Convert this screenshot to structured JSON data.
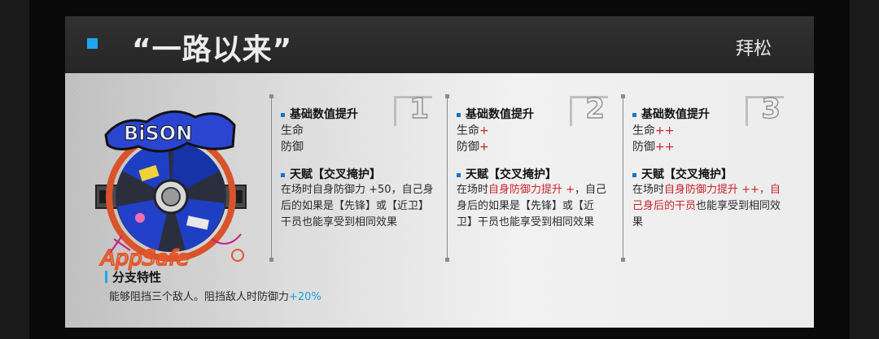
{
  "header": {
    "title": "“一路以来”",
    "operator": "拜松"
  },
  "levels": [
    {
      "num": "1",
      "stats_title": "基础数值提升",
      "stats": [
        {
          "label": "生命",
          "plus": ""
        },
        {
          "label": "防御",
          "plus": ""
        }
      ],
      "talent_title": "天赋【交叉掩护】",
      "talent_parts": [
        {
          "text": "在场时自身防御力 +50，自己身后的如果是【先锋】或【近卫】干员也能享受到相同效果",
          "red": false
        }
      ]
    },
    {
      "num": "2",
      "stats_title": "基础数值提升",
      "stats": [
        {
          "label": "生命",
          "plus": "+"
        },
        {
          "label": "防御",
          "plus": "+"
        }
      ],
      "talent_title": "天赋【交叉掩护】",
      "talent_parts": [
        {
          "text": "在场时",
          "red": false
        },
        {
          "text": "自身防御力提升 +",
          "red": true
        },
        {
          "text": "，自己身后的如果是【先锋】或【近卫】干员也能享受到相同效果",
          "red": false
        }
      ]
    },
    {
      "num": "3",
      "stats_title": "基础数值提升",
      "stats": [
        {
          "label": "生命",
          "plus": "++"
        },
        {
          "label": "防御",
          "plus": "++"
        }
      ],
      "talent_title": "天赋【交叉掩护】",
      "talent_parts": [
        {
          "text": "在场时",
          "red": false
        },
        {
          "text": "自身防御力提升 ++，自己身后的干员",
          "red": true
        },
        {
          "text": "也能享受到相同效果",
          "red": false
        }
      ]
    }
  ],
  "branch": {
    "title": "分支特性",
    "text": "能够阻挡三个敌人。阻挡敌人时防御力",
    "bonus": "+20%"
  },
  "colors": {
    "accent": "#1ea7ef",
    "upgrade": "#c8242a",
    "bullet": "#1a73c8"
  },
  "icons": {
    "token": "module-badge-shield-icon"
  }
}
